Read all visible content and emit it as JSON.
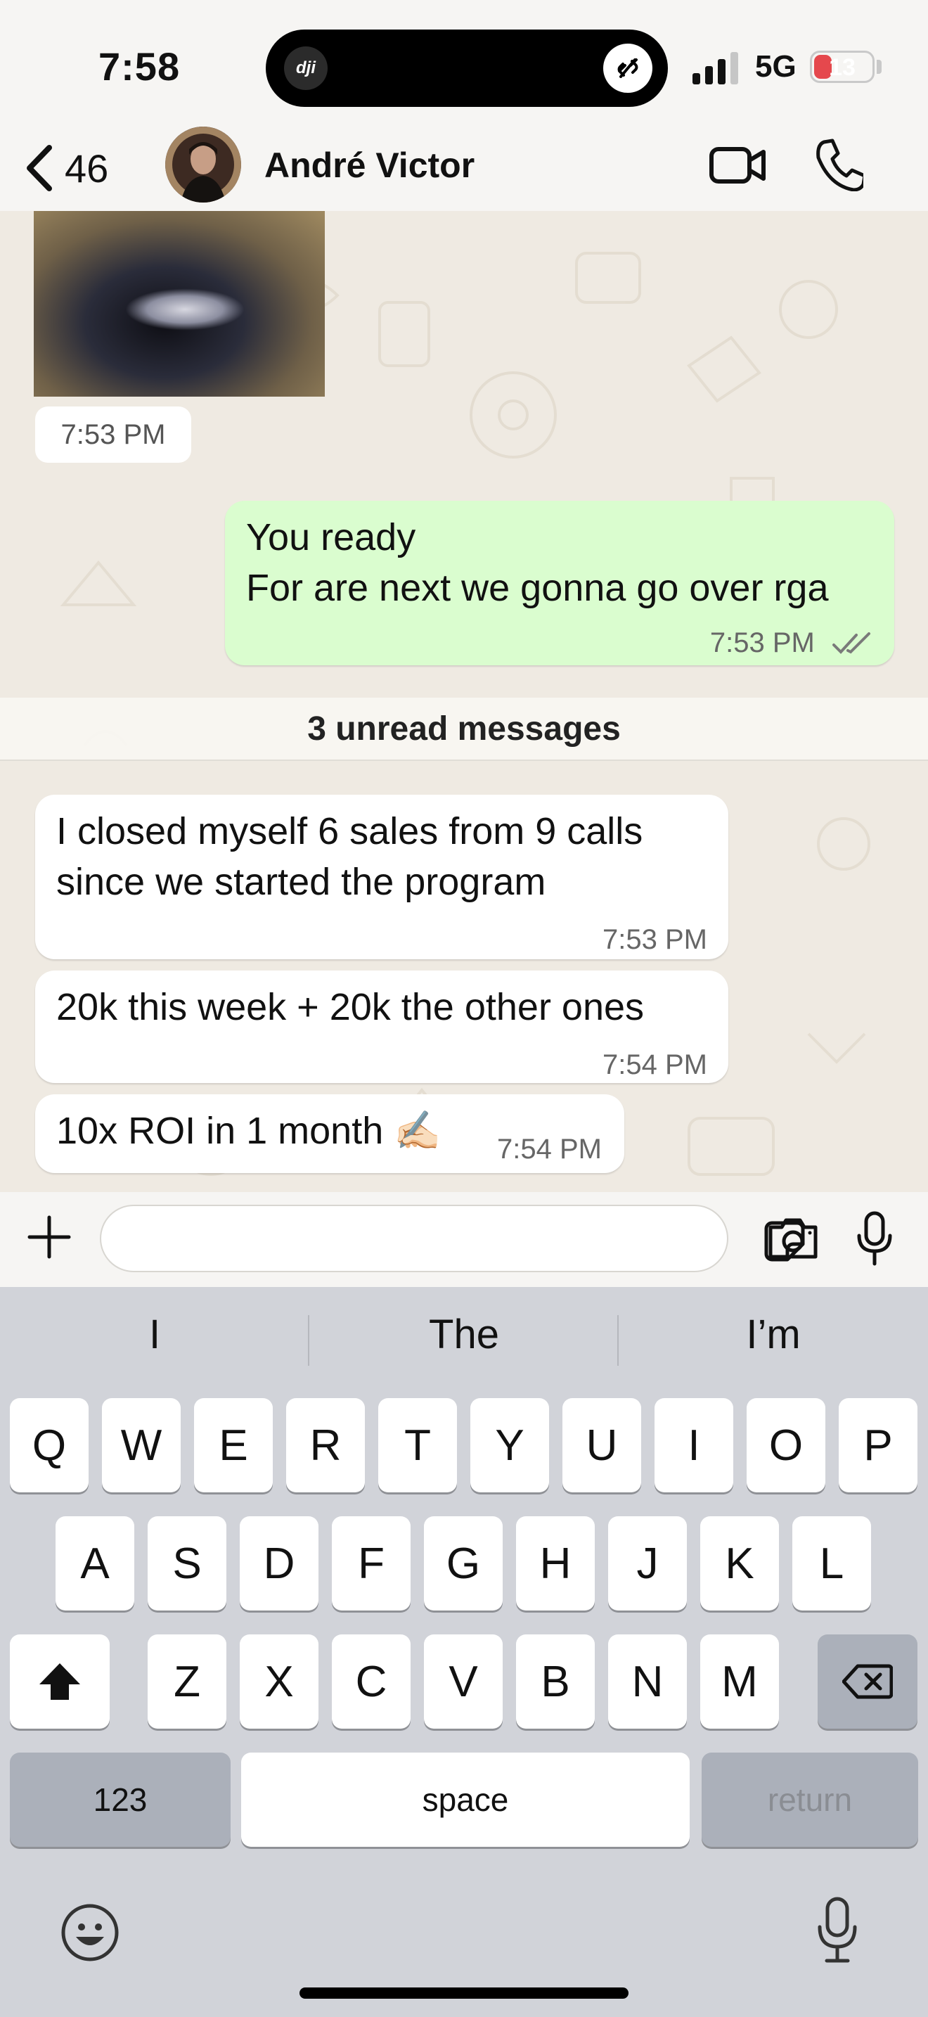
{
  "status_bar": {
    "time": "7:58",
    "island_app": "dji",
    "network": "5G",
    "battery": "13",
    "battery_level_percent": 13
  },
  "header": {
    "back_count": "46",
    "contact_name": "André Victor"
  },
  "messages": [
    {
      "type": "image",
      "direction": "incoming",
      "time": "7:53 PM"
    },
    {
      "type": "text",
      "direction": "outgoing",
      "lines": [
        "You ready",
        "For are next we gonna go over rga"
      ],
      "time": "7:53 PM",
      "status": "read"
    },
    {
      "type": "text",
      "direction": "incoming",
      "lines": [
        "I closed myself 6 sales from 9 calls",
        "since we started the program"
      ],
      "time": "7:53 PM"
    },
    {
      "type": "text",
      "direction": "incoming",
      "lines": [
        "20k this week + 20k the other ones"
      ],
      "time": "7:54 PM"
    },
    {
      "type": "text",
      "direction": "incoming",
      "lines": [
        "10x ROI in 1 month ✍🏻"
      ],
      "time": "7:54 PM"
    }
  ],
  "unread_banner": "3 unread messages",
  "composer": {
    "placeholder": ""
  },
  "keyboard": {
    "suggestions": [
      "I",
      "The",
      "I’m"
    ],
    "row1": [
      "Q",
      "W",
      "E",
      "R",
      "T",
      "Y",
      "U",
      "I",
      "O",
      "P"
    ],
    "row2": [
      "A",
      "S",
      "D",
      "F",
      "G",
      "H",
      "J",
      "K",
      "L"
    ],
    "row3": [
      "Z",
      "X",
      "C",
      "V",
      "B",
      "N",
      "M"
    ],
    "numbers_label": "123",
    "space_label": "space",
    "return_label": "return"
  },
  "colors": {
    "outgoing_bubble": "#dafdcf",
    "incoming_bubble": "#ffffff",
    "chat_background": "#efeae2",
    "read_ticks": "#53bdeb"
  }
}
